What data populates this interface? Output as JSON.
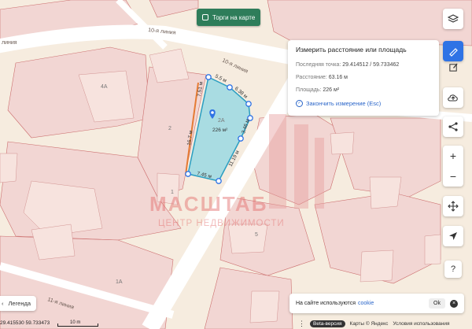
{
  "top_button": {
    "label": "Торги на карте"
  },
  "measure_panel": {
    "title": "Измерить расстояние или площадь",
    "last_point_label": "Последняя точка:",
    "last_point_value": "29.414512 / 59.733462",
    "distance_label": "Расстояние:",
    "distance_value": "63.16 м",
    "area_label": "Площадь:",
    "area_value": "226 м²",
    "finish_label": "Закончить измерение (Esc)"
  },
  "map": {
    "street_labels": [
      "10-я линия",
      "10-я линия",
      "11-я линия",
      "линия"
    ],
    "parcel_numbers": [
      "4А",
      "2",
      "1",
      "5",
      "6",
      "2А",
      "1А"
    ],
    "measure_area_label": "226 м²",
    "measure_point_label": "2А",
    "edge_labels": [
      "5.5 м",
      "6.38 м",
      "7.51 м",
      "16.7 м",
      "3.46 м",
      "11.19 м",
      "7.45 м"
    ],
    "watermark_top": "МАСШТАБ",
    "watermark_bottom": "ЦЕНТР НЕДВИЖИМОСТИ",
    "accent_color": "#2f73e5",
    "measure_fill": "#7fd4e3"
  },
  "controls": {
    "layers_icon": "layers-icon",
    "ruler_icon": "ruler-icon",
    "edit_icon": "edit-icon",
    "upload_icon": "cloud-upload-icon",
    "share_icon": "share-icon",
    "zoom_in": "+",
    "zoom_out": "−",
    "move_icon": "move-icon",
    "locate_icon": "locate-icon"
  },
  "legend": {
    "label": "Легенда",
    "chevron": "‹"
  },
  "coords": "29.415530  59.733473",
  "scale": {
    "label": "10 m"
  },
  "cookie": {
    "text": "На сайте используются",
    "link": "cookie",
    "ok": "Ok",
    "close": "×"
  },
  "footer": {
    "dots": "⋮",
    "beta": "Beta-версия",
    "maps": "Карты © Яндекс",
    "terms": "Условия использования"
  }
}
